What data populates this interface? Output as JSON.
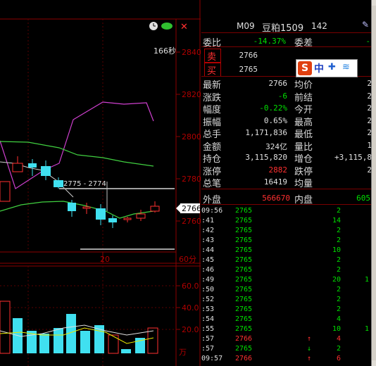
{
  "chart": {
    "price_ticks": [
      "2840",
      "2820",
      "2800",
      "2780",
      "2760"
    ],
    "countdown": "166秒",
    "current_price_tag": "2766",
    "range_label": "2775 - 2774",
    "date_label": "20",
    "period_label": "60分",
    "volume_ticks": [
      "60.0",
      "40.0",
      "20.0"
    ],
    "volume_unit": "万",
    "colors": {
      "up": "#ff3030",
      "down": "#40e0f0",
      "ma1": "#e0e0e0",
      "ma2": "#e8e800",
      "ma3": "#d040d0",
      "ma4": "#40d040",
      "grid": "#8b0000"
    }
  },
  "panel": {
    "header": {
      "code": "M09",
      "name": "豆粕1509",
      "number": "142"
    },
    "order_ratio": {
      "label": "委比",
      "value": "-14.37%",
      "diff_label": "委差",
      "diff_value": "-"
    },
    "sell": {
      "label": "卖",
      "price": "2766"
    },
    "buy": {
      "label": "买",
      "price": "2765"
    },
    "stats": [
      {
        "l1": "最新",
        "v1": "2766",
        "c1": "white",
        "l2": "均价",
        "v2": "2"
      },
      {
        "l1": "涨跌",
        "v1": "-6",
        "c1": "green",
        "l2": "前结",
        "v2": "2"
      },
      {
        "l1": "幅度",
        "v1": "-0.22%",
        "c1": "green",
        "l2": "今开",
        "v2": "2"
      },
      {
        "l1": "振幅",
        "v1": "0.65%",
        "c1": "white",
        "l2": "最高",
        "v2": "2"
      },
      {
        "l1": "总手",
        "v1": "1,171,836",
        "c1": "white",
        "l2": "最低",
        "v2": "2"
      },
      {
        "l1": "金额",
        "v1": "324亿",
        "c1": "white",
        "l2": "量比",
        "v2": "1"
      },
      {
        "l1": "持仓",
        "v1": "3,115,820",
        "c1": "white",
        "l2": "增仓",
        "v2": "+3,115,8"
      },
      {
        "l1": "涨停",
        "v1": "2882",
        "c1": "red",
        "l2": "跌停",
        "v2": "2"
      },
      {
        "l1": "总笔",
        "v1": "16419",
        "c1": "white",
        "l2": "均量",
        "v2": ""
      }
    ],
    "outer": {
      "label": "外盘",
      "value": "566670",
      "inner_label": "内盘",
      "inner_value": "605"
    },
    "ticks": [
      {
        "time": "09:56",
        "price": "2765",
        "vol": "2",
        "extra": ""
      },
      {
        "time": ":41",
        "price": "2765",
        "vol": "14",
        "extra": ""
      },
      {
        "time": ":42",
        "price": "2765",
        "vol": "2",
        "extra": ""
      },
      {
        "time": ":43",
        "price": "2765",
        "vol": "2",
        "extra": ""
      },
      {
        "time": ":44",
        "price": "2765",
        "vol": "10",
        "extra": ""
      },
      {
        "time": ":45",
        "price": "2765",
        "vol": "2",
        "extra": ""
      },
      {
        "time": ":46",
        "price": "2765",
        "vol": "2",
        "extra": ""
      },
      {
        "time": ":49",
        "price": "2765",
        "vol": "20",
        "extra": "1"
      },
      {
        "time": ":50",
        "price": "2765",
        "vol": "2",
        "extra": ""
      },
      {
        "time": ":52",
        "price": "2765",
        "vol": "2",
        "extra": ""
      },
      {
        "time": ":53",
        "price": "2765",
        "vol": "2",
        "extra": ""
      },
      {
        "time": ":54",
        "price": "2765",
        "vol": "4",
        "extra": ""
      },
      {
        "time": ":55",
        "price": "2765",
        "vol": "10",
        "extra": "1"
      },
      {
        "time": ":57",
        "price": "2766",
        "vol": "4",
        "extra": "",
        "arrow": "↑"
      },
      {
        "time": ":57",
        "price": "2765",
        "vol": "2",
        "extra": "",
        "arrow": "↓"
      },
      {
        "time": "09:57",
        "price": "2766",
        "vol": "6",
        "extra": "",
        "arrow": "↑"
      }
    ],
    "toolbar": {
      "s_label": "S",
      "zh_label": "中"
    }
  }
}
